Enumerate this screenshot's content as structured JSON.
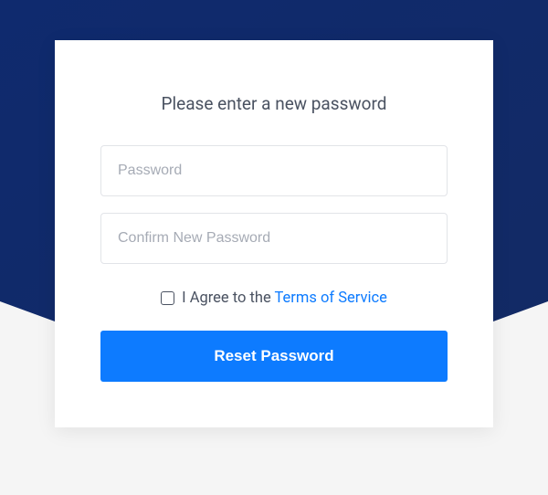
{
  "heading": "Please enter a new password",
  "password": {
    "placeholder": "Password",
    "value": ""
  },
  "confirm_password": {
    "placeholder": "Confirm New Password",
    "value": ""
  },
  "agree": {
    "prefix": "I Agree to the ",
    "link_text": "Terms of Service"
  },
  "submit_label": "Reset Password",
  "colors": {
    "background_dark": "#112a6b",
    "accent": "#0d7bff"
  }
}
